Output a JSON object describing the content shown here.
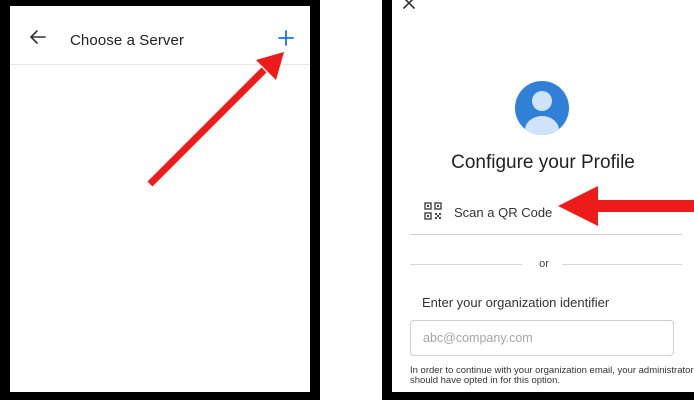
{
  "left_screen": {
    "header": {
      "title": "Choose a Server",
      "back_icon": "back-arrow-icon",
      "add_icon": "plus-icon"
    },
    "accent_color": "#1a73e8"
  },
  "right_screen": {
    "close_icon": "close-icon",
    "avatar_icon": "profile-avatar-icon",
    "title": "Configure your Profile",
    "qr_option": {
      "icon": "qr-code-icon",
      "label": "Scan a QR Code"
    },
    "divider_text": "or",
    "org_section": {
      "label": "Enter your organization identifier",
      "input_placeholder": "abc@company.com",
      "input_value": "",
      "helper_text": "In order to continue with your organization email, your administrator should have opted in for this option."
    },
    "avatar_color": "#2f80d6"
  },
  "annotation_color": "#ee1b1b"
}
